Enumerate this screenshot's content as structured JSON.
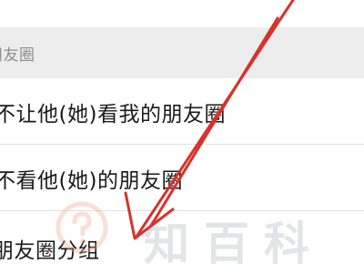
{
  "section_header": {
    "label": "朋友圈"
  },
  "menu": {
    "items": [
      {
        "label": "不让他(她)看我的朋友圈"
      },
      {
        "label": "不看他(她)的朋友圈"
      },
      {
        "label": "朋友圈分组"
      }
    ]
  },
  "watermark": {
    "text": "知百科"
  },
  "colors": {
    "annotation_arrow": "#d9312b",
    "section_background": "#ededed",
    "text_primary": "#1a1a1a",
    "text_secondary": "#8e8e8e"
  },
  "icons": {
    "watermark_logo": "question-mark-circle-icon"
  }
}
